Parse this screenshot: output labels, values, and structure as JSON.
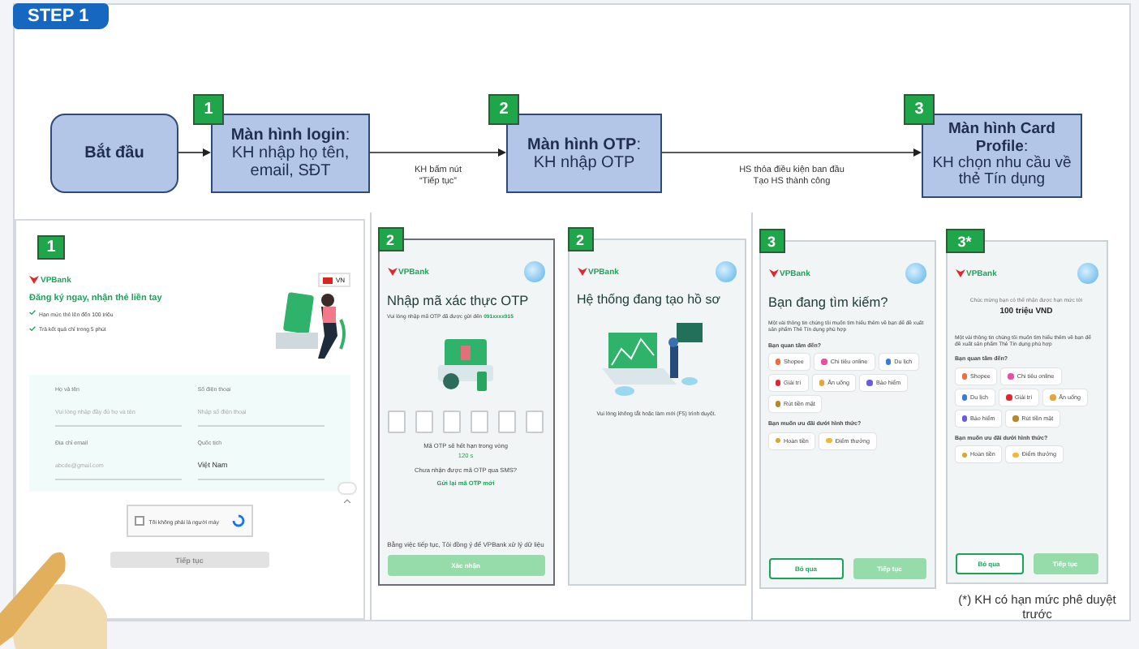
{
  "step_label": "STEP 1",
  "flow": {
    "start": "Bắt đầu",
    "steps": [
      {
        "badge": "1",
        "title": "**Màn hình login**:",
        "desc": "KH nhập họ tên, email, SĐT"
      },
      {
        "badge": "2",
        "title": "**Màn hình OTP**:",
        "desc": "KH nhập OTP"
      },
      {
        "badge": "3",
        "title": "**Màn hình Card Profile**:",
        "desc": "KH chọn nhu cầu về thẻ Tín dụng"
      }
    ],
    "transitions": [
      [
        "KH bấm nút",
        "“Tiếp tục”"
      ],
      [
        "HS thỏa điều kiện ban đầu",
        "Tạo HS thành công"
      ]
    ]
  },
  "screen_groups": [
    [
      {
        "kind": "login",
        "badge": "1",
        "logo": "VPBank",
        "language": "VN",
        "headline": "Đăng ký ngay, nhận thẻ liền tay",
        "bullets": [
          "Hạn mức thẻ lên đến 100 triệu",
          "Trả kết quả chỉ trong 5 phút"
        ],
        "fields": [
          {
            "label": "Họ và tên",
            "placeholder": "Vui lòng nhập đầy đủ họ và tên"
          },
          {
            "label": "Số điện thoại",
            "placeholder": "Nhập số điện thoại"
          },
          {
            "label": "Địa chỉ email",
            "placeholder": "abcde@gmail.com"
          },
          {
            "label": "Quốc tịch",
            "value": "Việt Nam"
          }
        ],
        "captcha": {
          "label": "Tôi không phải là người máy",
          "checked": false
        },
        "button": {
          "label": "Tiếp tục",
          "disabled": true
        }
      }
    ],
    [
      {
        "kind": "otp",
        "badge": "2",
        "logo": "VPBank",
        "title": "Nhập mã xác thực OTP",
        "instruction": "Vui lòng nhập mã OTP đã được gửi đến **091xxxx915**",
        "expiry": "Mã OTP sẽ hết hạn trong vòng",
        "countdown": "120 s",
        "resend_prompt": "Chưa nhận được mã OTP qua SMS?",
        "resend_link": "Gửi lại mã OTP mới",
        "consent": "Bằng việc tiếp tục, Tôi đồng ý để VPBank xử lý dữ liệu",
        "button": {
          "label": "Xác nhận",
          "disabled": true
        }
      },
      {
        "kind": "creating",
        "badge": "2",
        "logo": "VPBank",
        "title": "Hệ thống đang tạo hồ sơ",
        "message": "Vui lòng không tắt hoặc làm mới (F5) trình duyệt."
      }
    ],
    [
      {
        "kind": "profile",
        "badge": "3",
        "logo": "VPBank",
        "title": "Bạn đang tìm kiếm?",
        "intro": "Một vài thông tin chúng tôi muốn tìm hiểu thêm về bạn để đề xuất sản phẩm Thẻ Tín dụng phù hợp",
        "question_1": "Bạn quan tâm đến?",
        "interests": [
          {
            "label": "Shopee",
            "color": "#f26a3b"
          },
          {
            "label": "Chi tiêu online",
            "color": "#e84fa0"
          },
          {
            "label": "Du lịch",
            "color": "#3a7bd5"
          },
          {
            "label": "Giải trí",
            "color": "#e0262f"
          },
          {
            "label": "Ăn uống",
            "color": "#e8a33b"
          },
          {
            "label": "Bảo hiểm",
            "color": "#6a5ae0"
          },
          {
            "label": "Rút tiền mặt",
            "color": "#b8862b"
          }
        ],
        "question_2": "Bạn muốn ưu đãi dưới hình thức?",
        "rewards": [
          {
            "label": "Hoàn tiền",
            "color": "#d9a62e"
          },
          {
            "label": "Điểm thưởng",
            "color": "#f0b73a"
          }
        ],
        "buttons": [
          {
            "label": "Bỏ qua",
            "kind": "outline",
            "disabled": false
          },
          {
            "label": "Tiếp tục",
            "kind": "primary",
            "disabled": true
          }
        ]
      },
      {
        "kind": "profile",
        "badge": "3*",
        "logo": "VPBank",
        "congrats": "Chúc mừng bạn có thể nhận được hạn mức tới",
        "amount": "100 triệu VND",
        "intro": "Một vài thông tin chúng tôi muốn tìm hiểu thêm về bạn để đề xuất sản phẩm Thẻ Tín dụng phù hợp",
        "question_1": "Bạn quan tâm đến?",
        "interests": [
          {
            "label": "Shopee",
            "color": "#f26a3b"
          },
          {
            "label": "Chi tiêu online",
            "color": "#e84fa0"
          },
          {
            "label": "Du lịch",
            "color": "#3a7bd5"
          },
          {
            "label": "Giải trí",
            "color": "#e0262f"
          },
          {
            "label": "Ăn uống",
            "color": "#e8a33b"
          },
          {
            "label": "Bảo hiểm",
            "color": "#6a5ae0"
          },
          {
            "label": "Rút tiền mặt",
            "color": "#b8862b"
          }
        ],
        "question_2": "Bạn muốn ưu đãi dưới hình thức?",
        "rewards": [
          {
            "label": "Hoàn tiền",
            "color": "#d9a62e"
          },
          {
            "label": "Điểm thưởng",
            "color": "#f0b73a"
          }
        ],
        "buttons": [
          {
            "label": "Bỏ qua",
            "kind": "outline",
            "disabled": false
          },
          {
            "label": "Tiếp tục",
            "kind": "primary",
            "disabled": true
          }
        ],
        "footnote": "(*) KH có hạn mức phê duyệt trước"
      }
    ]
  ]
}
